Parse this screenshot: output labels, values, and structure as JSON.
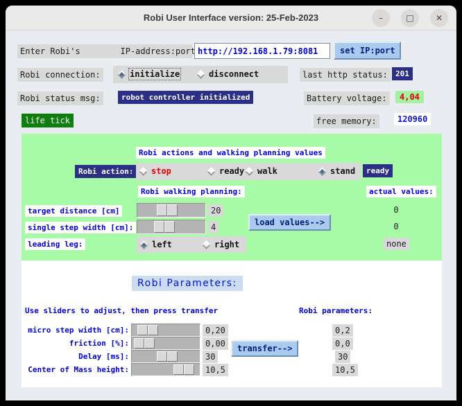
{
  "window": {
    "title": "Robi User Interface    version: 25-Feb-2023",
    "minimize_icon": "–",
    "maximize_icon": "□",
    "close_icon": "✕"
  },
  "top": {
    "ip_label": "Enter Robi's        IP-address:port",
    "ip_value": "http://192.168.1.79:8081",
    "set_ip_button": "set IP:port",
    "connection_label": "Robi connection:",
    "connection_options": [
      "initialize",
      "disconnect"
    ],
    "connection_selected": "initialize",
    "last_http_status_label": "last http status:",
    "last_http_status_value": "201",
    "status_msg_label": "Robi status msg:",
    "status_msg_value": "robot controller initialized",
    "battery_label": "Battery voltage:",
    "battery_value": "4,04",
    "life_tick_label": "life tick",
    "free_memory_label": "free memory:",
    "free_memory_value": "120960"
  },
  "actions": {
    "heading": "Robi actions and walking planning values",
    "action_label": "Robi action:",
    "action_options": [
      "stop",
      "ready",
      "walk",
      "stand"
    ],
    "action_selected": "stand",
    "action_status": "ready",
    "planning_heading": "Robi walking planning:",
    "actual_heading": "actual values:",
    "target_distance_label": "target distance [cm]",
    "target_distance_value": "20",
    "target_distance_actual": "0",
    "step_width_label": "single step width [cm]:",
    "step_width_value": "4",
    "step_width_actual": "0",
    "leading_leg_label": "leading leg:",
    "leading_leg_options": [
      "left",
      "right"
    ],
    "leading_leg_selected": "left",
    "leading_leg_actual": "none",
    "load_button": "load values-->"
  },
  "params": {
    "heading": "Robi Parameters:",
    "instruction": "Use sliders to adjust, then press transfer",
    "actual_heading": "Robi parameters:",
    "transfer_button": "transfer-->",
    "rows": [
      {
        "label": "micro step width [cm]:",
        "value": "0,20",
        "actual": "0,2"
      },
      {
        "label": "friction [%]:",
        "value": "0,00",
        "actual": "0,0"
      },
      {
        "label": "Delay [ms]:",
        "value": "30",
        "actual": "30"
      },
      {
        "label": "Center of Mass height:",
        "value": "10,5",
        "actual": "10,5"
      }
    ]
  },
  "colors": {
    "navy_badge": "#2b2f85",
    "green_badge": "#0f7d0f",
    "panel_green": "#a7fba7",
    "button_blue": "#abcbee",
    "heading_blue": "#0000cd",
    "value_red": "#e00000",
    "label_gray": "#d9d9d9",
    "params_heading_bg": "#ccdcf2"
  }
}
